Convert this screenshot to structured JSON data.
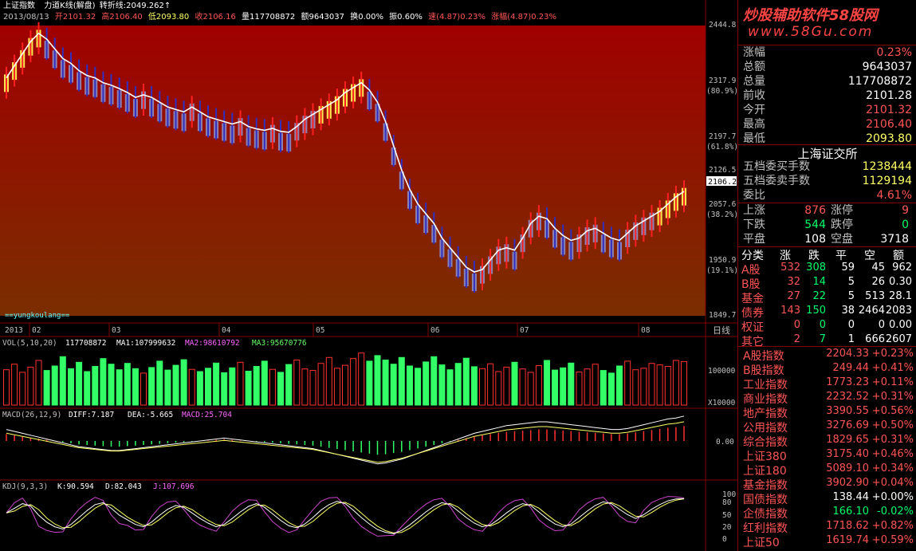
{
  "topbar": {
    "line1": {
      "title": "上证指数",
      "formula": "力道K线(解盘)",
      "turn_label": "转折线:",
      "turn_value": "2049.262",
      "arrow": "↑"
    },
    "line2": {
      "date": "2013/08/13",
      "open": "开2101.32",
      "high": "高2106.40",
      "low": "低2093.80",
      "close": "收2106.16",
      "volume": "量117708872",
      "amount": "额9643037",
      "turnover": "换0.00%",
      "amplitude": "振0.60%",
      "speed": "速(4.87)0.23%",
      "change": "涨幅(4.87)0.23%"
    }
  },
  "main_axis": {
    "labels": [
      "2444.8",
      "2317.9",
      "(80.9%)",
      "2197.7",
      "(61.8%)",
      "2126.5",
      "2057.6",
      "(38.2%)",
      "1950.9",
      "(19.1%)",
      "1849.7"
    ],
    "current_price": "2106.2",
    "watermark": "==yungkoulang=="
  },
  "time_axis": {
    "labels": [
      "2013",
      "02",
      "03",
      "04",
      "05",
      "06",
      "07",
      "08"
    ],
    "period": "日线"
  },
  "vol_panel": {
    "title": "VOL(5,10,20)",
    "v": "117708872",
    "ma1": "MA1:107999632",
    "ma2": "MA2:98610792",
    "ma3": "MA3:95670776",
    "axis_label": "100000",
    "unit": "X10000"
  },
  "macd_panel": {
    "title": "MACD(26,12,9)",
    "diff": "DIFF:7.187",
    "dea": "DEA:-5.665",
    "macd": "MACD:25.704",
    "axis_label": "0.00"
  },
  "kdj_panel": {
    "title": "KDJ(9,3,3)",
    "k": "K:90.594",
    "d": "D:82.043",
    "j": "J:107.696",
    "axis": [
      "100",
      "80",
      "50",
      "20",
      "0"
    ]
  },
  "brand": {
    "title": "炒股辅助软件58股网",
    "url": "www.58Gu.com"
  },
  "quote": [
    {
      "label": "涨幅",
      "value": "0.23%",
      "color": "red"
    },
    {
      "label": "总额",
      "value": "9643037",
      "color": "white"
    },
    {
      "label": "总量",
      "value": "117708872",
      "color": "white"
    },
    {
      "label": "前收",
      "value": "2101.28",
      "color": "white"
    },
    {
      "label": "今开",
      "value": "2101.32",
      "color": "red"
    },
    {
      "label": "最高",
      "value": "2106.40",
      "color": "red"
    },
    {
      "label": "最低",
      "value": "2093.80",
      "color": "yellow"
    }
  ],
  "exchange": "上海证交所",
  "orders": [
    {
      "label": "五档委买手数",
      "value": "1238444",
      "color": "yellow"
    },
    {
      "label": "五档委卖手数",
      "value": "1129194",
      "color": "yellow"
    },
    {
      "label": "委比",
      "value": "4.61%",
      "color": "red"
    }
  ],
  "breadth": {
    "up_label": "上涨",
    "up": "876",
    "limit_up_label": "涨停",
    "limit_up": "9",
    "down_label": "下跌",
    "down": "544",
    "limit_down_label": "跌停",
    "limit_down": "0",
    "flat_label": "平盘",
    "flat": "108",
    "empty_label": "空盘",
    "empty": "3718"
  },
  "category_table": {
    "headers": [
      "分类",
      "涨",
      "跌",
      "平",
      "空",
      "额"
    ],
    "rows": [
      [
        "A股",
        "532",
        "308",
        "59",
        "45",
        "962"
      ],
      [
        "B股",
        "32",
        "14",
        "5",
        "26",
        "0.30"
      ],
      [
        "基金",
        "27",
        "22",
        "5",
        "513",
        "28.1"
      ],
      [
        "债券",
        "143",
        "150",
        "38",
        "2464",
        "2083"
      ],
      [
        "权证",
        "0",
        "0",
        "0",
        "0",
        "0.00"
      ],
      [
        "其它",
        "2",
        "7",
        "1",
        "666",
        "2607"
      ]
    ]
  },
  "indices": [
    {
      "name": "A股指数",
      "price": "2204.33",
      "chg": "+0.23%",
      "color": "red"
    },
    {
      "name": "B股指数",
      "price": "249.44",
      "chg": "+0.41%",
      "color": "red"
    },
    {
      "name": "工业指数",
      "price": "1773.23",
      "chg": "+0.11%",
      "color": "red"
    },
    {
      "name": "商业指数",
      "price": "2232.52",
      "chg": "+0.31%",
      "color": "red"
    },
    {
      "name": "地产指数",
      "price": "3390.55",
      "chg": "+0.56%",
      "color": "red"
    },
    {
      "name": "公用指数",
      "price": "3276.69",
      "chg": "+0.50%",
      "color": "red"
    },
    {
      "name": "综合指数",
      "price": "1829.65",
      "chg": "+0.31%",
      "color": "red"
    },
    {
      "name": "上证380",
      "price": "3175.40",
      "chg": "+0.46%",
      "color": "red"
    },
    {
      "name": "上证180",
      "price": "5089.10",
      "chg": "+0.34%",
      "color": "red"
    },
    {
      "name": "基金指数",
      "price": "3902.90",
      "chg": "+0.04%",
      "color": "red"
    },
    {
      "name": "国债指数",
      "price": "138.44",
      "chg": "+0.00%",
      "color": "white"
    },
    {
      "name": "企债指数",
      "price": "166.10",
      "chg": "-0.02%",
      "color": "green"
    },
    {
      "name": "红利指数",
      "price": "1718.62",
      "chg": "+0.82%",
      "color": "red"
    },
    {
      "name": "上证50",
      "price": "1619.74",
      "chg": "+0.59%",
      "color": "red"
    }
  ],
  "chart_data": {
    "type": "line",
    "price_series": [
      2340,
      2365,
      2390,
      2415,
      2432,
      2420,
      2400,
      2380,
      2370,
      2355,
      2345,
      2340,
      2330,
      2325,
      2318,
      2310,
      2300,
      2305,
      2300,
      2290,
      2280,
      2275,
      2270,
      2280,
      2270,
      2260,
      2255,
      2250,
      2245,
      2250,
      2240,
      2235,
      2232,
      2236,
      2230,
      2228,
      2240,
      2255,
      2265,
      2275,
      2285,
      2295,
      2310,
      2320,
      2330,
      2315,
      2290,
      2250,
      2200,
      2150,
      2110,
      2080,
      2060,
      2040,
      2010,
      1990,
      1970,
      1950,
      1940,
      1945,
      1965,
      1985,
      1990,
      1985,
      2010,
      2040,
      2055,
      2050,
      2030,
      2015,
      2005,
      2010,
      2025,
      2030,
      2020,
      2010,
      2005,
      2020,
      2035,
      2045,
      2055,
      2065,
      2080,
      2095,
      2106
    ],
    "vol_series": [
      95,
      110,
      88,
      102,
      120,
      93,
      105,
      130,
      98,
      115,
      90,
      104,
      125,
      110,
      95,
      112,
      98,
      86,
      101,
      118,
      94,
      107,
      122,
      96,
      90,
      99,
      113,
      87,
      100,
      115,
      91,
      104,
      118,
      96,
      88,
      109,
      121,
      97,
      93,
      112,
      128,
      99,
      107,
      125,
      140,
      118,
      133,
      121,
      110,
      128,
      105,
      99,
      116,
      130,
      108,
      95,
      112,
      126,
      103,
      98,
      111,
      90,
      102,
      115,
      97,
      88,
      106,
      120,
      94,
      100,
      113,
      89,
      97,
      110,
      93,
      86,
      105,
      118,
      95,
      99,
      112,
      108,
      104,
      120,
      117
    ],
    "macd_series": [
      12,
      10,
      8,
      6,
      4,
      2,
      0,
      -2,
      -4,
      -6,
      -7,
      -8,
      -9,
      -10,
      -10,
      -9,
      -8,
      -7,
      -6,
      -5,
      -4,
      -3,
      -2,
      -1,
      0,
      1,
      2,
      3,
      2,
      1,
      0,
      -1,
      -2,
      -3,
      -4,
      -5,
      -6,
      -7,
      -8,
      -10,
      -12,
      -14,
      -16,
      -18,
      -20,
      -22,
      -24,
      -23,
      -21,
      -19,
      -16,
      -13,
      -10,
      -7,
      -4,
      -1,
      2,
      5,
      8,
      10,
      12,
      14,
      16,
      17,
      18,
      19,
      20,
      20,
      19,
      18,
      17,
      16,
      15,
      14,
      13,
      12,
      12,
      13,
      15,
      17,
      19,
      21,
      23,
      24,
      26
    ],
    "kdj_k": [
      60,
      70,
      80,
      75,
      55,
      40,
      30,
      25,
      35,
      50,
      65,
      78,
      82,
      70,
      55,
      45,
      35,
      30,
      40,
      55,
      68,
      76,
      72,
      60,
      48,
      38,
      30,
      35,
      48,
      62,
      74,
      80,
      72,
      58,
      44,
      32,
      28,
      36,
      50,
      66,
      78,
      85,
      80,
      66,
      50,
      36,
      24,
      18,
      15,
      22,
      34,
      48,
      62,
      74,
      82,
      78,
      64,
      50,
      38,
      30,
      34,
      46,
      60,
      72,
      80,
      76,
      62,
      48,
      36,
      30,
      36,
      50,
      64,
      76,
      84,
      80,
      68,
      56,
      48,
      56,
      68,
      78,
      86,
      90,
      91
    ]
  }
}
